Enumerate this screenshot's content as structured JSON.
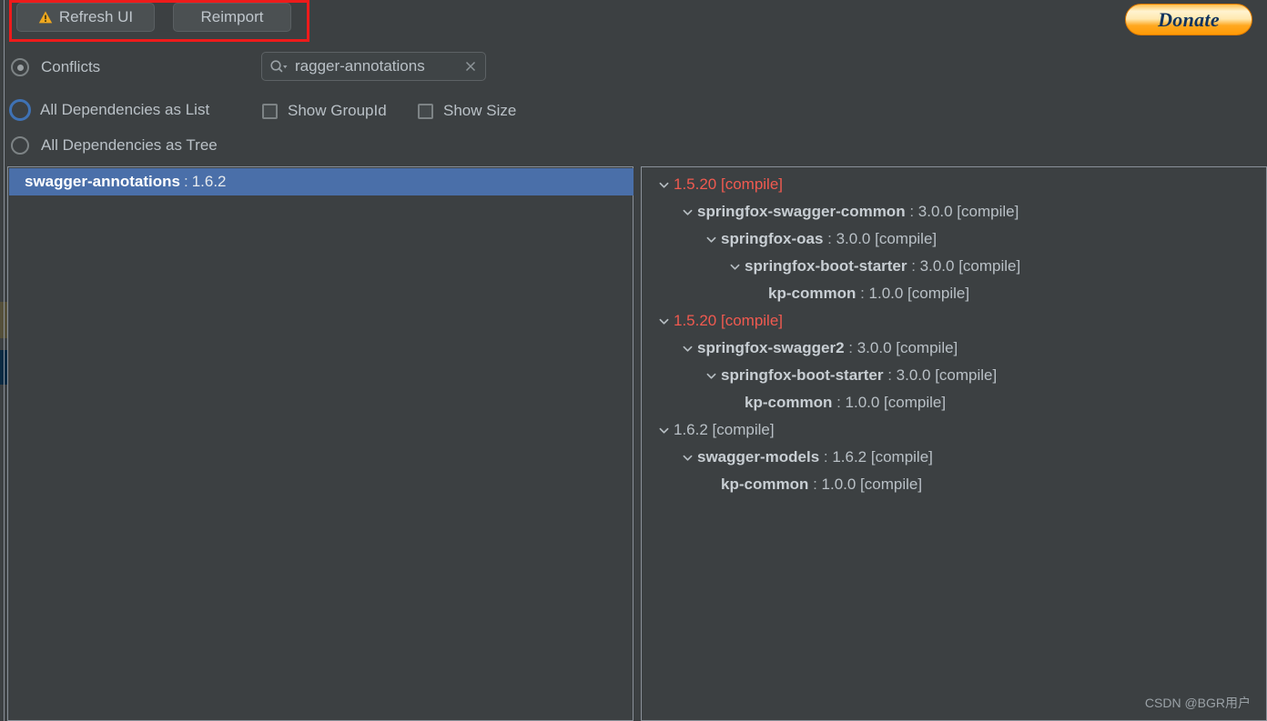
{
  "toolbar": {
    "refresh_label": "Refresh UI",
    "reimport_label": "Reimport",
    "warning_icon": "warning-triangle-icon",
    "donate_label": "Donate"
  },
  "options": {
    "radios": [
      {
        "label": "Conflicts",
        "selected": true,
        "focused": false
      },
      {
        "label": "All Dependencies as List",
        "selected": false,
        "focused": true
      },
      {
        "label": "All Dependencies as Tree",
        "selected": false,
        "focused": false
      }
    ],
    "checkboxes": [
      {
        "label": "Show GroupId",
        "checked": false
      },
      {
        "label": "Show Size",
        "checked": false
      }
    ]
  },
  "search": {
    "icon": "search-icon",
    "value": "ragger-annotations",
    "clear_icon": "clear-icon"
  },
  "left_panel": {
    "selected_item": {
      "name": "swagger-annotations",
      "separator": ":",
      "version": "1.6.2"
    }
  },
  "right_panel": {
    "tree": [
      {
        "indent": 0,
        "chevron": true,
        "name": "",
        "separator": "",
        "version": "1.5.20 [compile]",
        "conflict": true
      },
      {
        "indent": 1,
        "chevron": true,
        "name": "springfox-swagger-common",
        "separator": ":",
        "version": "3.0.0 [compile]",
        "conflict": false
      },
      {
        "indent": 2,
        "chevron": true,
        "name": "springfox-oas",
        "separator": ":",
        "version": "3.0.0 [compile]",
        "conflict": false
      },
      {
        "indent": 3,
        "chevron": true,
        "name": "springfox-boot-starter",
        "separator": ":",
        "version": "3.0.0 [compile]",
        "conflict": false
      },
      {
        "indent": 4,
        "chevron": false,
        "name": "kp-common",
        "separator": ":",
        "version": "1.0.0 [compile]",
        "conflict": false
      },
      {
        "indent": 0,
        "chevron": true,
        "name": "",
        "separator": "",
        "version": "1.5.20 [compile]",
        "conflict": true
      },
      {
        "indent": 1,
        "chevron": true,
        "name": "springfox-swagger2",
        "separator": ":",
        "version": "3.0.0 [compile]",
        "conflict": false
      },
      {
        "indent": 2,
        "chevron": true,
        "name": "springfox-boot-starter",
        "separator": ":",
        "version": "3.0.0 [compile]",
        "conflict": false
      },
      {
        "indent": 3,
        "chevron": false,
        "name": "kp-common",
        "separator": ":",
        "version": "1.0.0 [compile]",
        "conflict": false
      },
      {
        "indent": 0,
        "chevron": true,
        "name": "",
        "separator": "",
        "version": "1.6.2 [compile]",
        "conflict": false
      },
      {
        "indent": 1,
        "chevron": true,
        "name": "swagger-models",
        "separator": ":",
        "version": "1.6.2 [compile]",
        "conflict": false
      },
      {
        "indent": 2,
        "chevron": false,
        "name": "kp-common",
        "separator": ":",
        "version": "1.0.0 [compile]",
        "conflict": false
      }
    ]
  },
  "watermark": {
    "text": "CSDN @BGR用户"
  },
  "colors": {
    "background": "#3c4042",
    "selection": "#4a6fa9",
    "conflict": "#f05a50",
    "annotation": "#ee1b1b",
    "accent": "#3f72b5",
    "donate_orange": "#ffa81f"
  }
}
